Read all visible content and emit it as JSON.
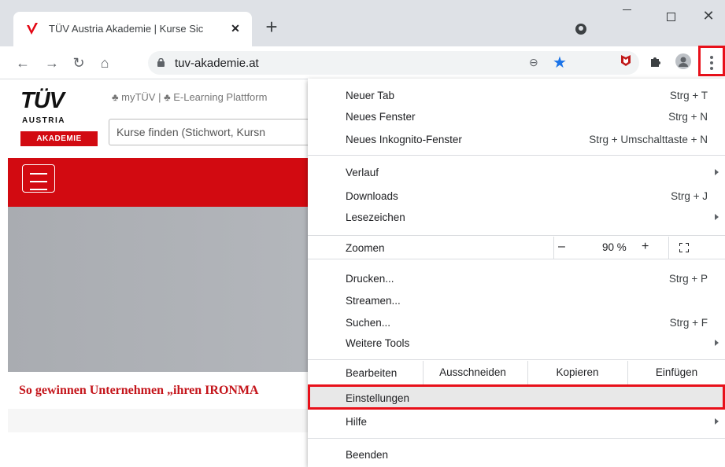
{
  "tab": {
    "title": "TÜV Austria Akademie | Kurse Sic",
    "close": "✕"
  },
  "toolbar": {
    "url": "tuv-akademie.at"
  },
  "page": {
    "logo_main": "TÜV",
    "logo_sub": "AUSTRIA",
    "logo_badge": "AKADEMIE",
    "toplinks": "♣ myTÜV | ♣ E-Learning Plattform",
    "search_placeholder": "Kurse finden (Stichwort, Kursn",
    "headline": "So gewinnen Unternehmen „ihren IRONMA"
  },
  "menu": {
    "group1": [
      {
        "label": "Neuer Tab",
        "shortcut": "Strg + T"
      },
      {
        "label": "Neues Fenster",
        "shortcut": "Strg + N"
      },
      {
        "label": "Neues Inkognito-Fenster",
        "shortcut": "Strg + Umschalttaste + N"
      }
    ],
    "group2": [
      {
        "label": "Verlauf"
      },
      {
        "label": "Downloads",
        "shortcut": "Strg + J"
      },
      {
        "label": "Lesezeichen"
      }
    ],
    "zoom": {
      "label": "Zoomen",
      "minus": "–",
      "value": "90 %",
      "plus": "+"
    },
    "group3": [
      {
        "label": "Drucken...",
        "shortcut": "Strg + P"
      },
      {
        "label": "Streamen..."
      },
      {
        "label": "Suchen...",
        "shortcut": "Strg + F"
      },
      {
        "label": "Weitere Tools"
      }
    ],
    "edit": {
      "label": "Bearbeiten",
      "cut": "Ausschneiden",
      "copy": "Kopieren",
      "paste": "Einfügen"
    },
    "settings": "Einstellungen",
    "help": "Hilfe",
    "exit": "Beenden"
  },
  "colors": {
    "brand_red": "#d20a11",
    "highlight_red": "#e8101a",
    "accent_blue": "#1a73e8"
  },
  "icons": [
    "back-icon",
    "forward-icon",
    "reload-icon",
    "home-icon",
    "lock-icon",
    "zoom-icon",
    "star-icon",
    "mcafee-icon",
    "extensions-icon",
    "profile-icon",
    "kebab-menu-icon",
    "fullscreen-icon"
  ]
}
